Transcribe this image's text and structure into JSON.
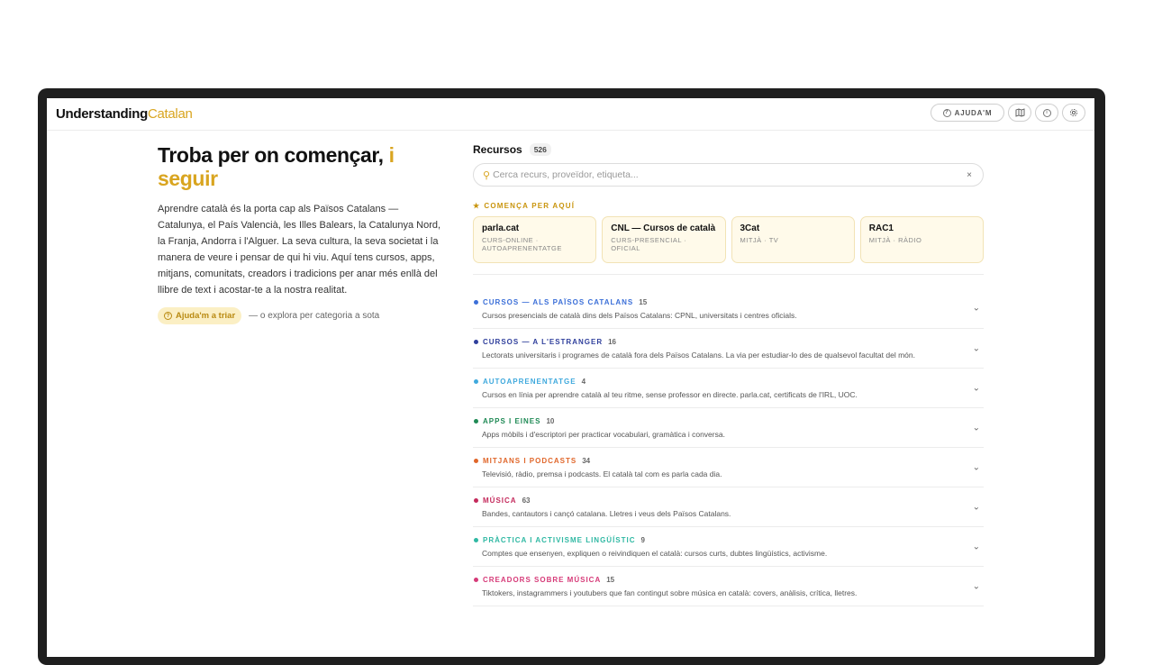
{
  "header": {
    "logo_bold": "Understanding",
    "logo_light": "Catalan",
    "help_label": "AJUDA'M",
    "icons": [
      "help-circle-icon",
      "map-icon",
      "info-icon",
      "settings-icon"
    ]
  },
  "hero": {
    "title_main": "Troba per on començar,",
    "title_accent_1": "i",
    "title_accent_2": "seguir",
    "text": "Aprendre català és la porta cap als Països Catalans — Catalunya, el País Valencià, les Illes Balears, la Catalunya Nord, la Franja, Andorra i l'Alguer. La seva cultura, la seva societat i la manera de veure i pensar de qui hi viu. Aquí tens cursos, apps, mitjans, comunitats, creadors i tradicions per anar més enllà del llibre de text i acostar-te a la nostra realitat.",
    "cta_label": "Ajuda'm a triar",
    "cta_hint": "— o explora per categoria a sota"
  },
  "resources": {
    "title": "Recursos",
    "count": "526",
    "search_placeholder": "Cerca recurs, proveïdor, etiqueta...",
    "clear": "×",
    "start_label": "COMENÇA PER AQUÍ",
    "start_cards": [
      {
        "name": "parla.cat",
        "tag": "CURS-ONLINE · AUTOAPRENENTATGE"
      },
      {
        "name": "CNL — Cursos de català",
        "tag": "CURS-PRESENCIAL · OFICIAL"
      },
      {
        "name": "3Cat",
        "tag": "MITJÀ · TV"
      },
      {
        "name": "RAC1",
        "tag": "MITJÀ · RÀDIO"
      }
    ],
    "categories": [
      {
        "name": "CURSOS — ALS PAÏSOS CATALANS",
        "count": "15",
        "color": "#3b6fd8",
        "desc": "Cursos presencials de català dins dels Països Catalans: CPNL, universitats i centres oficials."
      },
      {
        "name": "CURSOS — A L'ESTRANGER",
        "count": "16",
        "color": "#2f3f9c",
        "desc": "Lectorats universitaris i programes de català fora dels Països Catalans. La via per estudiar-lo des de qualsevol facultat del món."
      },
      {
        "name": "AUTOAPRENENTATGE",
        "count": "4",
        "color": "#3fa9dd",
        "desc": "Cursos en línia per aprendre català al teu ritme, sense professor en directe. parla.cat, certificats de l'IRL, UOC."
      },
      {
        "name": "APPS I EINES",
        "count": "10",
        "color": "#1f8a55",
        "desc": "Apps mòbils i d'escriptori per practicar vocabulari, gramàtica i conversa."
      },
      {
        "name": "MITJANS I PODCASTS",
        "count": "34",
        "color": "#e0662a",
        "desc": "Televisió, ràdio, premsa i podcasts. El català tal com es parla cada dia."
      },
      {
        "name": "MÚSICA",
        "count": "63",
        "color": "#c42a5c",
        "desc": "Bandes, cantautors i cançó catalana. Lletres i veus dels Països Catalans."
      },
      {
        "name": "PRÀCTICA I ACTIVISME LINGÜÍSTIC",
        "count": "9",
        "color": "#2fb8a3",
        "desc": "Comptes que ensenyen, expliquen o reivindiquen el català: cursos curts, dubtes lingüístics, activisme."
      },
      {
        "name": "CREADORS SOBRE MÚSICA",
        "count": "15",
        "color": "#d63a78",
        "desc": "Tiktokers, instagrammers i youtubers que fan contingut sobre música en català: covers, anàlisis, crítica, lletres."
      }
    ]
  }
}
